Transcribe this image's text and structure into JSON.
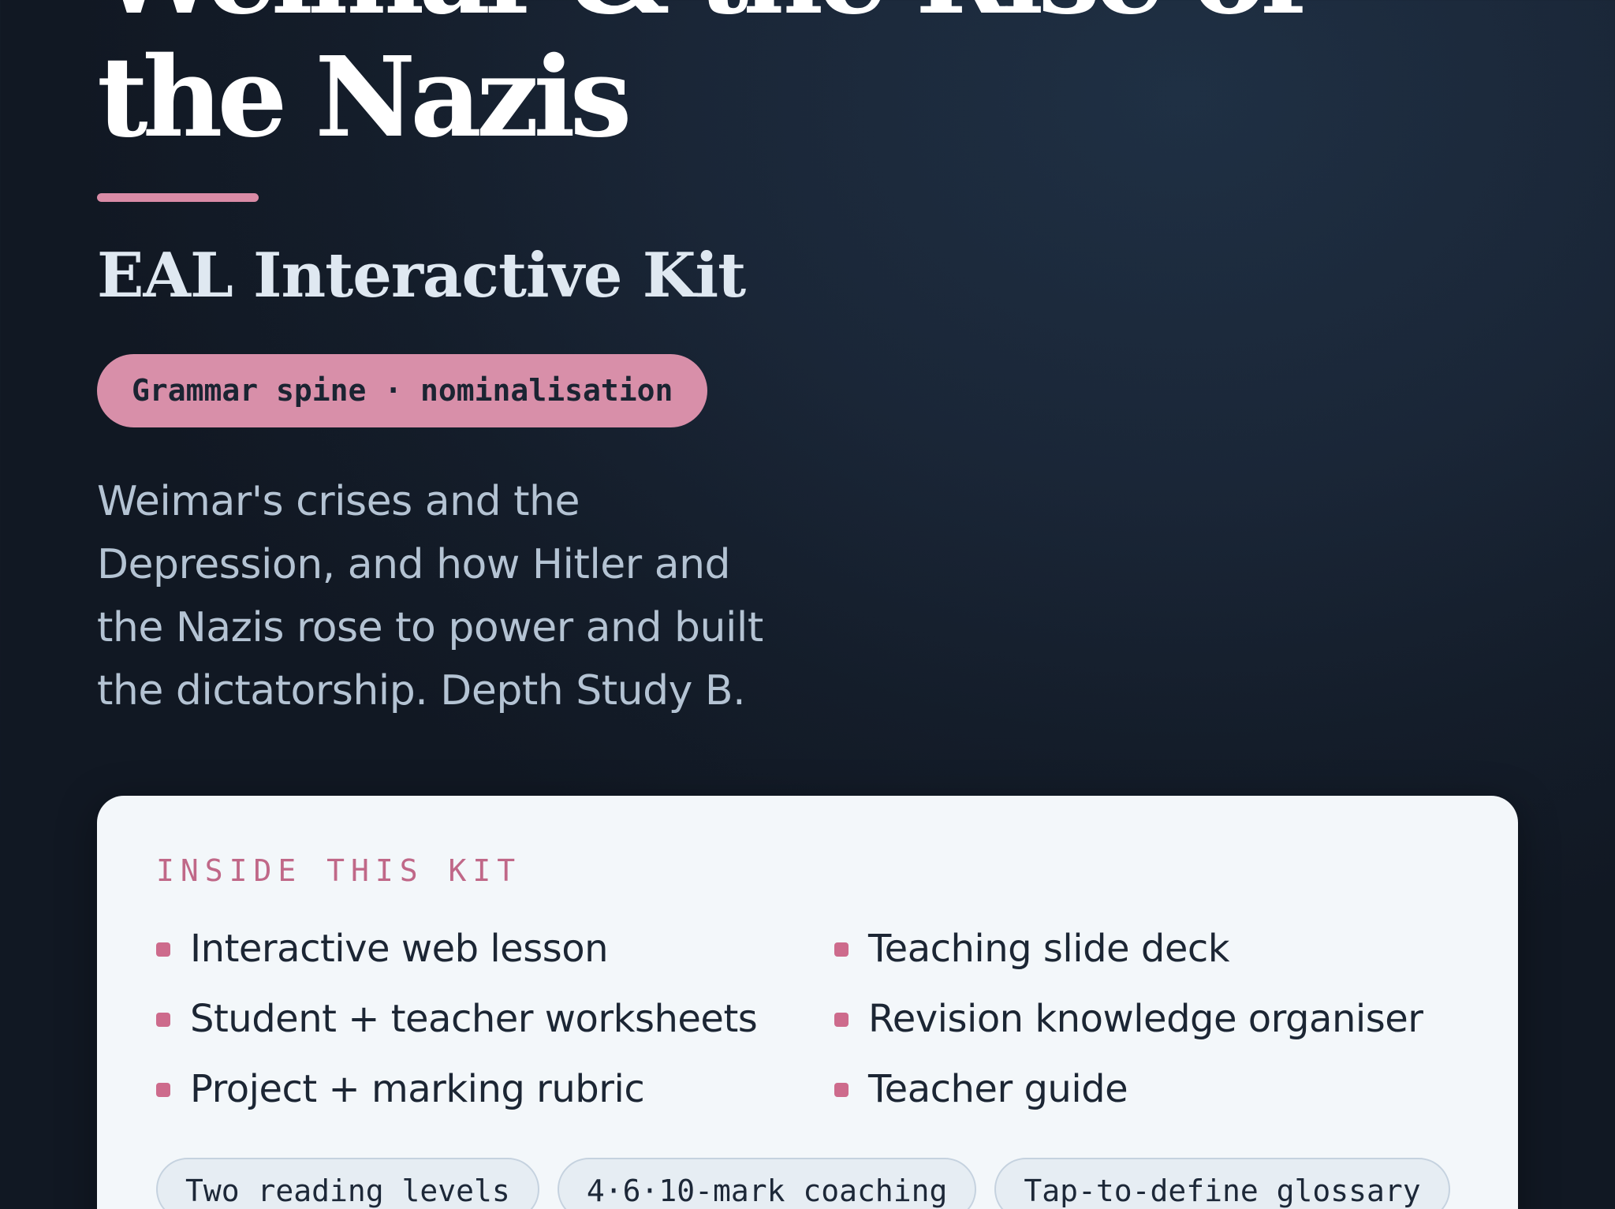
{
  "hero": {
    "title_line_1": "Weimar & the Rise of",
    "title_line_2": "the Nazis",
    "subtitle": "EAL Interactive Kit",
    "tag": "Grammar spine · nominalisation",
    "description": "Weimar's crises and the Depression, and how Hitler and the Nazis rose to power and built the dictatorship. Depth Study B."
  },
  "kit": {
    "heading": "INSIDE THIS KIT",
    "column_a": [
      "Interactive web lesson",
      "Student + teacher worksheets",
      "Project + marking rubric"
    ],
    "column_b": [
      "Teaching slide deck",
      "Revision knowledge organiser",
      "Teacher guide"
    ],
    "features": [
      "Two reading levels",
      "4·6·10-mark coaching",
      "Tap-to-define glossary"
    ]
  },
  "colors": {
    "accent": "#d98ba6",
    "bullet": "#cd6b8c",
    "background": "#172230",
    "card": "#f3f7fa"
  }
}
